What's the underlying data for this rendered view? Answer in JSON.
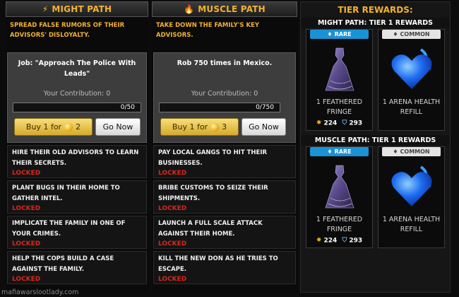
{
  "might": {
    "header": "MIGHT PATH",
    "icon": "lightning-icon",
    "goal": "SPREAD FALSE RUMORS OF THEIR ADVISORS' DISLOYALTY.",
    "job_title": "Job: \"Approach The Police With Leads\"",
    "contribution": "Your Contribution: 0",
    "progress": "0/50",
    "progress_fraction": 0,
    "buy_label": "Buy 1 for",
    "buy_cost": "2",
    "go_label": "Go Now",
    "steps": [
      {
        "text": "HIRE THEIR OLD ADVISORS TO LEARN THEIR SECRETS.",
        "status": "LOCKED"
      },
      {
        "text": "PLANT BUGS IN THEIR HOME TO GATHER INTEL.",
        "status": "LOCKED"
      },
      {
        "text": "IMPLICATE THE FAMILY IN ONE OF YOUR CRIMES.",
        "status": "LOCKED"
      },
      {
        "text": "HELP THE COPS BUILD A CASE AGAINST THE FAMILY.",
        "status": "LOCKED"
      }
    ]
  },
  "muscle": {
    "header": "MUSCLE PATH",
    "icon": "flame-icon",
    "goal": "TAKE DOWN THE FAMILY'S KEY ADVISORS.",
    "job_title": "Rob 750 times in Mexico.",
    "contribution": "Your Contribution: 0",
    "progress": "0/750",
    "progress_fraction": 0,
    "buy_label": "Buy 1 for",
    "buy_cost": "3",
    "go_label": "Go Now",
    "steps": [
      {
        "text": "PAY LOCAL GANGS TO HIT THEIR BUSINESSES.",
        "status": "LOCKED"
      },
      {
        "text": "BRIBE CUSTOMS TO SEIZE THEIR SHIPMENTS.",
        "status": "LOCKED"
      },
      {
        "text": "LAUNCH A FULL SCALE ATTACK AGAINST THEIR HOME.",
        "status": "LOCKED"
      },
      {
        "text": "KILL THE NEW DON AS HE TRIES TO ESCAPE.",
        "status": "LOCKED"
      }
    ]
  },
  "tier": {
    "title": "TIER REWARDS:",
    "sections": [
      {
        "label": "MIGHT PATH: TIER 1 REWARDS",
        "rewards": [
          {
            "rarity": "RARE",
            "rarity_icon": "diamond-icon",
            "name": "1 FEATHERED FRINGE",
            "attack": "224",
            "defense": "293",
            "image": "dress-icon"
          },
          {
            "rarity": "COMMON",
            "rarity_icon": "diamond-icon",
            "name": "1 ARENA HEALTH REFILL",
            "image": "blue-heart-icon"
          }
        ]
      },
      {
        "label": "MUSCLE PATH: TIER 1 REWARDS",
        "rewards": [
          {
            "rarity": "RARE",
            "rarity_icon": "diamond-icon",
            "name": "1 FEATHERED FRINGE",
            "attack": "224",
            "defense": "293",
            "image": "dress-icon"
          },
          {
            "rarity": "COMMON",
            "rarity_icon": "diamond-icon",
            "name": "1 ARENA HEALTH REFILL",
            "image": "blue-heart-icon"
          }
        ]
      }
    ]
  },
  "watermark": "mafiawarslootlady.com",
  "colors": {
    "accent": "#f3b230",
    "locked": "#d9261c",
    "rare": "#1a92d6",
    "common": "#e4e4e4"
  }
}
